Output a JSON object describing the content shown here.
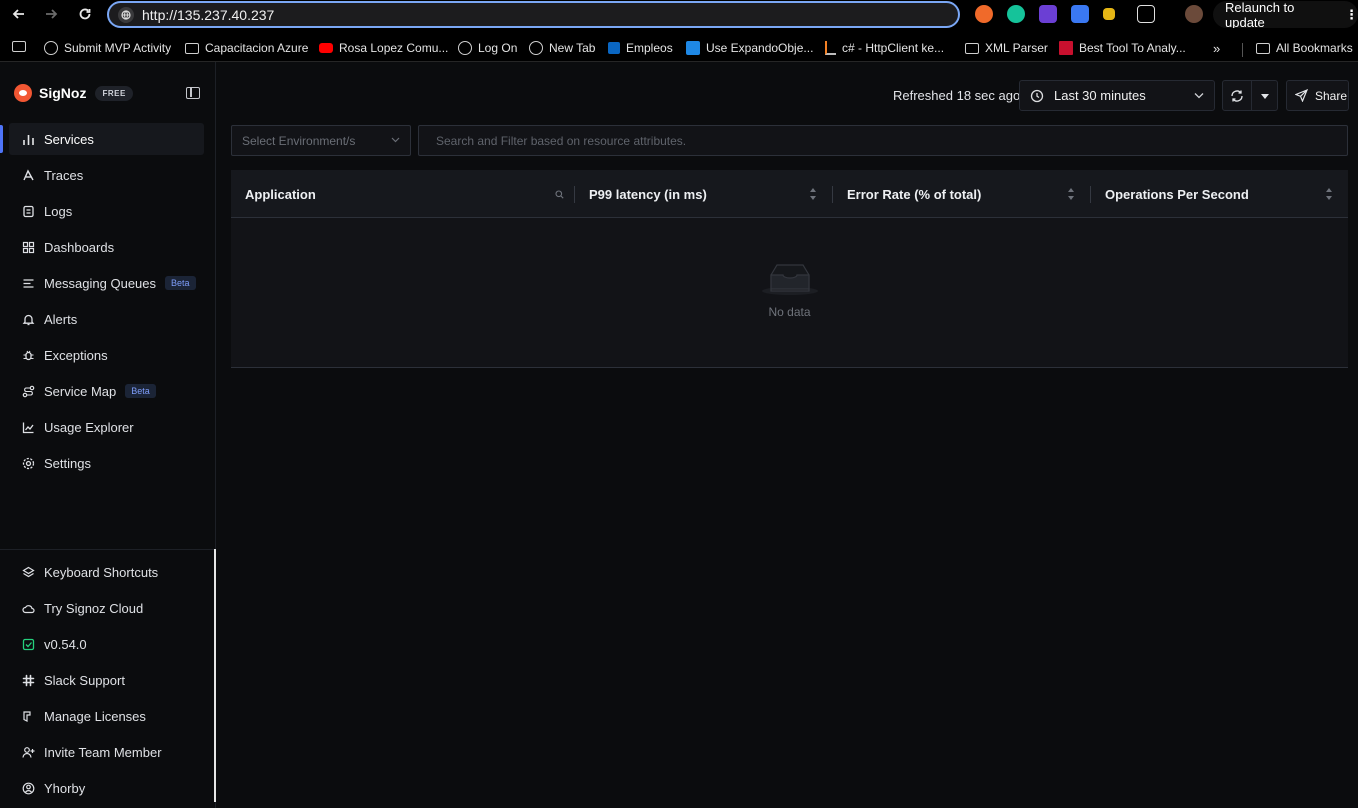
{
  "browser": {
    "url": "http://135.237.40.237",
    "relaunch_label": "Relaunch to update",
    "bookmarks": [
      {
        "label": "Submit MVP Activity",
        "icon": "globe-icon"
      },
      {
        "label": "Capacitacion Azure",
        "icon": "folder-icon"
      },
      {
        "label": "Rosa Lopez Comu...",
        "icon": "youtube-icon"
      },
      {
        "label": "Log On",
        "icon": "globe-icon"
      },
      {
        "label": "New Tab",
        "icon": "globe-icon"
      },
      {
        "label": "Empleos",
        "icon": "linkedin-icon"
      },
      {
        "label": "Use ExpandoObje...",
        "icon": "site-icon"
      },
      {
        "label": "c# - HttpClient ke...",
        "icon": "stackoverflow-icon"
      },
      {
        "label": "XML Parser",
        "icon": "folder-icon"
      },
      {
        "label": "Best Tool To Analy...",
        "icon": "site-icon"
      }
    ],
    "more_bookmarks": "»",
    "all_bookmarks": "All Bookmarks"
  },
  "app": {
    "brand": "SigNoz",
    "plan_badge": "FREE",
    "nav": [
      {
        "label": "Services",
        "icon": "bar-chart-icon",
        "active": true
      },
      {
        "label": "Traces",
        "icon": "route-icon"
      },
      {
        "label": "Logs",
        "icon": "scroll-icon"
      },
      {
        "label": "Dashboards",
        "icon": "layout-grid-icon"
      },
      {
        "label": "Messaging Queues",
        "icon": "list-icon",
        "badge": "Beta"
      },
      {
        "label": "Alerts",
        "icon": "bell-icon"
      },
      {
        "label": "Exceptions",
        "icon": "bug-icon"
      },
      {
        "label": "Service Map",
        "icon": "route-icon",
        "badge": "Beta"
      },
      {
        "label": "Usage Explorer",
        "icon": "line-chart-icon"
      },
      {
        "label": "Settings",
        "icon": "gear-icon"
      }
    ],
    "bottom_nav": [
      {
        "label": "Keyboard Shortcuts",
        "icon": "layers-icon"
      },
      {
        "label": "Try Signoz Cloud",
        "icon": "cloud-icon"
      },
      {
        "label": "v0.54.0",
        "icon": "check-square-icon"
      },
      {
        "label": "Slack Support",
        "icon": "slack-icon"
      },
      {
        "label": "Manage Licenses",
        "icon": "key-icon"
      },
      {
        "label": "Invite Team Member",
        "icon": "user-plus-icon"
      },
      {
        "label": "Yhorby",
        "icon": "user-circle-icon"
      }
    ]
  },
  "toolbar": {
    "refreshed_text": "Refreshed 18 sec ago",
    "time_range": "Last 30 minutes",
    "share_label": "Share"
  },
  "filters": {
    "environment_placeholder": "Select Environment/s",
    "search_placeholder": "Search and Filter based on resource attributes."
  },
  "table": {
    "columns": [
      "Application",
      "P99 latency (in ms)",
      "Error Rate (% of total)",
      "Operations Per Second"
    ],
    "empty_text": "No data"
  },
  "colors": {
    "accent": "#4e74f8",
    "brand": "#f25733",
    "beta_text": "#7d9cf8"
  }
}
